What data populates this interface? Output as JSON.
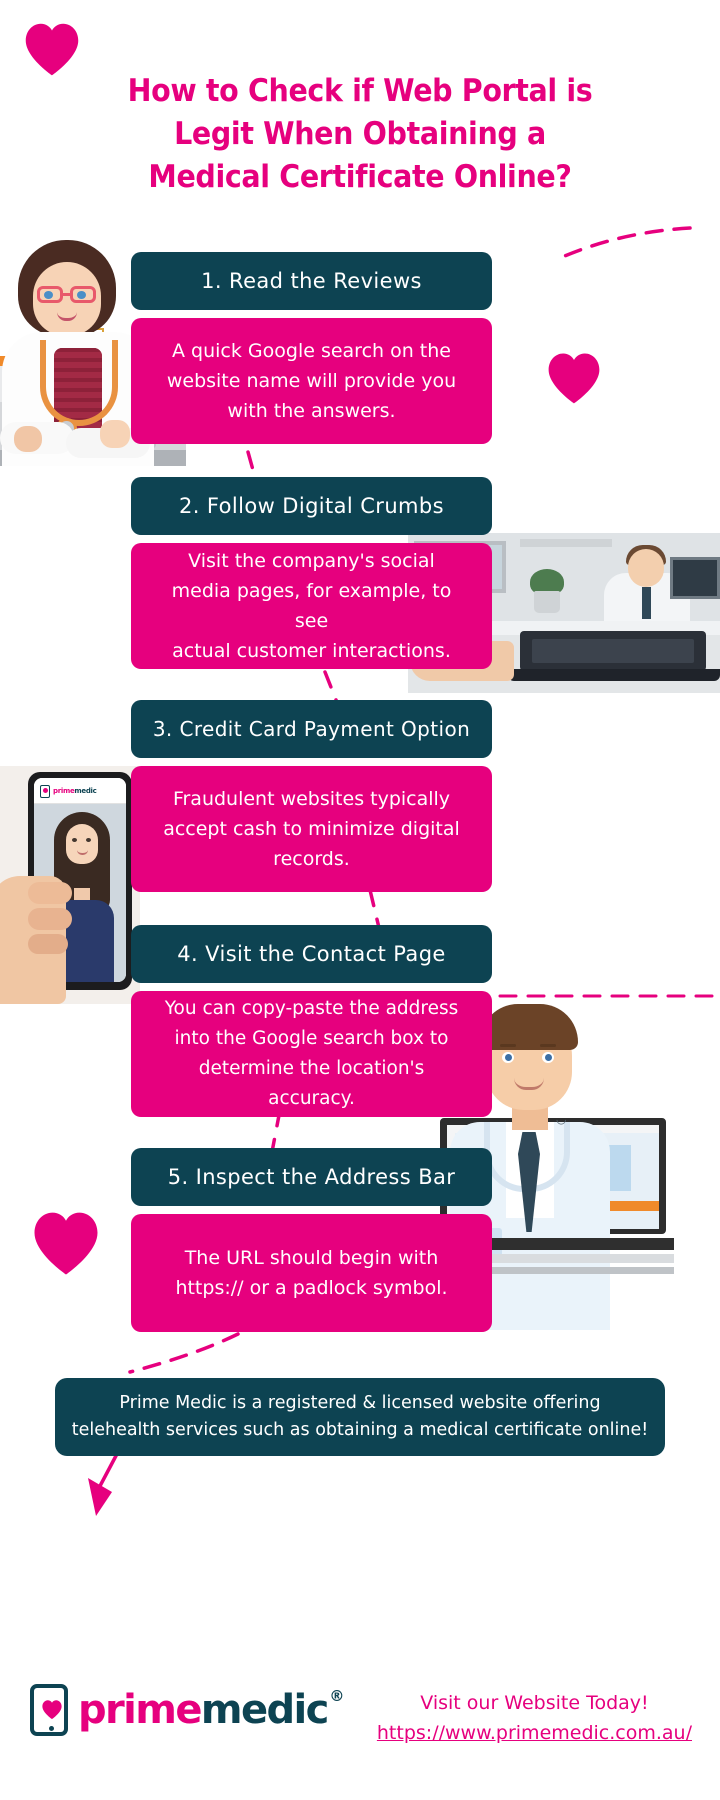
{
  "theme": {
    "pink": "#e6007e",
    "teal": "#0d4352",
    "white": "#ffffff"
  },
  "title": {
    "line1": "How to Check if Web Portal is",
    "line2": "Legit When Obtaining a",
    "line3": "Medical Certificate Online?"
  },
  "steps": [
    {
      "heading": "1. Read the Reviews",
      "body_lines": [
        "A quick Google search on the",
        "website name will provide you",
        "with the answers."
      ]
    },
    {
      "heading": "2. Follow Digital Crumbs",
      "body_lines": [
        "Visit the company's social",
        "media pages, for example, to see",
        "actual customer interactions."
      ]
    },
    {
      "heading": "3. Credit Card Payment Option",
      "body_lines": [
        "Fraudulent websites typically",
        "accept cash to minimize digital",
        "records."
      ]
    },
    {
      "heading": "4. Visit the Contact Page",
      "body_lines": [
        "You can copy-paste the address",
        "into the Google search box to",
        "determine the location's accuracy."
      ]
    },
    {
      "heading": "5. Inspect the Address Bar",
      "body_lines": [
        "The URL should begin with",
        "https:// or a padlock symbol."
      ]
    }
  ],
  "banner": {
    "line1": "Prime Medic is a registered & licensed website offering",
    "line2": "telehealth services such as obtaining a medical certificate online!"
  },
  "footer": {
    "logo_prime": "prime",
    "logo_medic": "medic",
    "logo_registered": "®",
    "cta_heading": "Visit our Website Today!",
    "cta_url": "https://www.primemedic.com.au/"
  },
  "icons": {
    "heart_top_left": "heart-icon",
    "heart_mid_right": "heart-icon",
    "heart_bottom_left": "heart-icon",
    "logo_phone": "phone-icon",
    "logo_heart": "heart-icon",
    "arrow_to_logo": "arrow-down-icon"
  }
}
